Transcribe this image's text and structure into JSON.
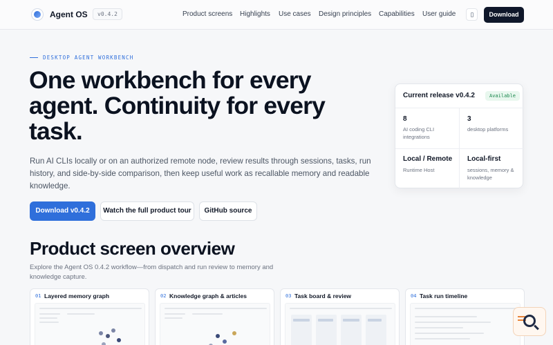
{
  "header": {
    "brand": "Agent OS",
    "version": "v0.4.2",
    "nav": [
      "Product screens",
      "Highlights",
      "Use cases",
      "Design principles",
      "Capabilities",
      "User guide"
    ],
    "download_label": "Download"
  },
  "hero": {
    "eyebrow": "DESKTOP AGENT WORKBENCH",
    "title": "One workbench for every agent. Continuity for every task.",
    "description": "Run AI CLIs locally or on an authorized remote node, review results through sessions, tasks, run history, and side-by-side comparison, then keep useful work as recallable memory and readable knowledge.",
    "buttons": {
      "primary": "Download v0.4.2",
      "tour": "Watch the full product tour",
      "github": "GitHub source"
    }
  },
  "release": {
    "title": "Current release v0.4.2",
    "badge": "Available",
    "stats": [
      {
        "value": "8",
        "label": "AI coding CLI integrations"
      },
      {
        "value": "3",
        "label": "desktop platforms"
      },
      {
        "value": "Local / Remote",
        "label": "Runtime Host"
      },
      {
        "value": "Local-first",
        "label": "sessions, memory & knowledge"
      }
    ],
    "badge_color": "#18864b"
  },
  "overview": {
    "title": "Product screen overview",
    "description": "Explore the Agent OS 0.4.2 workflow—from dispatch and run review to memory and knowledge capture.",
    "cards": [
      {
        "num": "01",
        "title": "Layered memory graph"
      },
      {
        "num": "02",
        "title": "Knowledge graph & articles"
      },
      {
        "num": "03",
        "title": "Task board & review"
      },
      {
        "num": "04",
        "title": "Task run timeline"
      }
    ]
  },
  "colors": {
    "accent": "#2f6fdb",
    "dark_button": "#0f172a"
  }
}
